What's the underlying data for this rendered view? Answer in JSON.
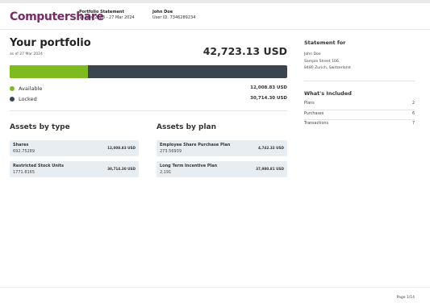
{
  "header": {
    "logo_text": "Computershare",
    "logo_color": "#7a2a66",
    "statement_title": "Portfolio Statement",
    "statement_period": "10 Nov 2023 - 27 Mar 2024",
    "holder_name": "John Doe",
    "holder_id": "User ID: 7346289234"
  },
  "portfolio": {
    "title": "Your portfolio",
    "as_of": "as of 27 Mar 2024",
    "total": "42,723.13 USD",
    "available_fraction": 0.2814,
    "available_color": "#7dbb1e",
    "locked_color": "#3b4550",
    "legend": [
      {
        "label": "Available",
        "value": "12,008.83 USD"
      },
      {
        "label": "Locked",
        "value": "30,714.30 USD"
      }
    ]
  },
  "assets_by_type": {
    "title": "Assets by type",
    "items": [
      {
        "name": "Shares",
        "quantity": "692.75289",
        "value": "12,008.83 USD"
      },
      {
        "name": "Restricted Stock Units",
        "quantity": "1771.8165",
        "value": "30,714.30 USD"
      }
    ]
  },
  "assets_by_plan": {
    "title": "Assets by plan",
    "items": [
      {
        "name": "Employee Share Purchase Plan",
        "quantity": "273.56939",
        "value": "4,742.32 USD"
      },
      {
        "name": "Long Term Incentive Plan",
        "quantity": "2,191",
        "value": "37,980.81 USD"
      }
    ]
  },
  "sidebar": {
    "statement_for_title": "Statement for",
    "address_lines": [
      "John Doe",
      "Sample Street 106",
      "8480 Zurich, Switzerland"
    ],
    "included_title": "What's Included",
    "included": [
      {
        "label": "Plans",
        "count": "2"
      },
      {
        "label": "Purchases",
        "count": "6"
      },
      {
        "label": "Transactions",
        "count": "7"
      }
    ]
  },
  "footer": {
    "page": "Page 1/14"
  }
}
